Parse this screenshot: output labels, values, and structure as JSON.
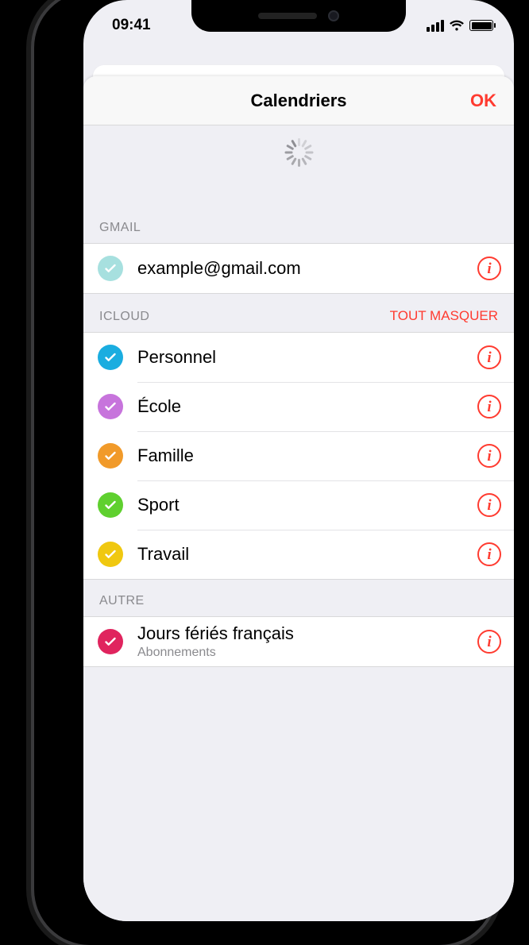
{
  "status": {
    "time": "09:41"
  },
  "nav": {
    "title": "Calendriers",
    "done": "OK"
  },
  "sections": [
    {
      "header": "GMAIL",
      "action": "",
      "items": [
        {
          "title": "example@gmail.com",
          "subtitle": "",
          "color": "#a7e0df"
        }
      ]
    },
    {
      "header": "ICLOUD",
      "action": "TOUT MASQUER",
      "items": [
        {
          "title": "Personnel",
          "subtitle": "",
          "color": "#1aade0"
        },
        {
          "title": "École",
          "subtitle": "",
          "color": "#c774dc"
        },
        {
          "title": "Famille",
          "subtitle": "",
          "color": "#f19a2a"
        },
        {
          "title": "Sport",
          "subtitle": "",
          "color": "#5fd02f"
        },
        {
          "title": "Travail",
          "subtitle": "",
          "color": "#f0c810"
        }
      ]
    },
    {
      "header": "AUTRE",
      "action": "",
      "items": [
        {
          "title": "Jours fériés français",
          "subtitle": "Abonnements",
          "color": "#e0245e"
        }
      ]
    }
  ]
}
